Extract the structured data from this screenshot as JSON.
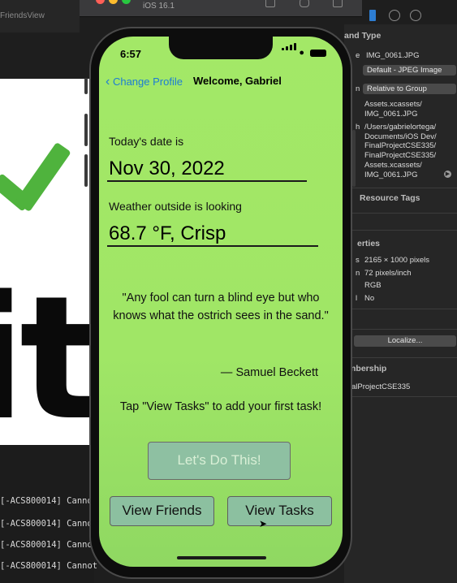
{
  "xcode": {
    "simulator_title": "iOS 16.1",
    "left_tab": "FriendsView",
    "console_lines": [
      "[-ACS800014] Canno",
      "[-ACS800014] Canno",
      "[-ACS800014] Canno",
      "[-ACS800014] Cannot"
    ],
    "inspector": {
      "section_name_type": "and Type",
      "file_name": "IMG_0061.JPG",
      "file_type_popup": "Default - JPEG Image",
      "location_popup": "Relative to Group",
      "relative_path": [
        "Assets.xcassets/",
        "IMG_0061.JPG"
      ],
      "full_path": [
        "/Users/gabrielortega/",
        "Documents/iOS Dev/",
        "FinalProjectCSE335/",
        "FinalProjectCSE335/",
        "Assets.xcassets/",
        "IMG_0061.JPG"
      ],
      "section_resource_tags": "Resource Tags",
      "section_properties": "erties",
      "dimensions": "2165 × 1000 pixels",
      "resolution": "72 pixels/inch",
      "color_space": "RGB",
      "alpha": "No",
      "localize_button": "Localize...",
      "section_membership": "nbership",
      "target_name": "alProjectCSE335",
      "label_prefixes": [
        "e",
        "n",
        "h",
        "s",
        "n",
        "l"
      ]
    }
  },
  "status_bar": {
    "time": "6:57"
  },
  "nav": {
    "back_label": "Change Profile",
    "title": "Welcome, Gabriel"
  },
  "date_section": {
    "label": "Today's date is",
    "value": "Nov 30, 2022"
  },
  "weather_section": {
    "label": "Weather outside is looking",
    "value": "68.7 °F, Crisp"
  },
  "quote": {
    "text": "\"Any fool can turn a blind eye but who knows what the ostrich sees in the sand.\"",
    "author": "— Samuel Beckett"
  },
  "hint": "Tap \"View Tasks\" to add your first task!",
  "buttons": {
    "lets_do_this": "Let's Do This!",
    "view_friends": "View Friends",
    "view_tasks": "View Tasks"
  },
  "colors": {
    "screen_green": "#a3e867",
    "button_teal": "#8cc0a0",
    "link_blue": "#1c7cd6"
  }
}
